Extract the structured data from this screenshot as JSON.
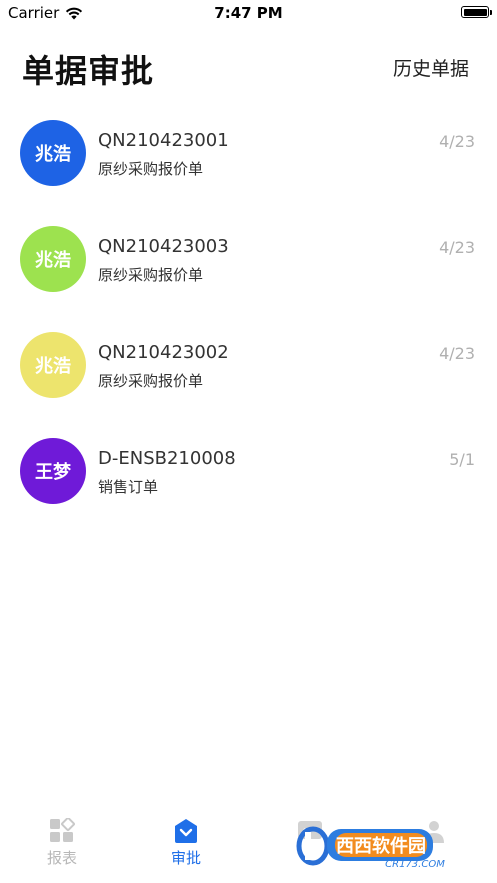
{
  "status_bar": {
    "carrier": "Carrier",
    "time": "7:47 PM"
  },
  "header": {
    "title": "单据审批",
    "history_label": "历史单据"
  },
  "items": [
    {
      "avatar_text": "兆浩",
      "avatar_color": "#1e63e5",
      "doc_no": "QN210423001",
      "doc_type": "原纱采购报价单",
      "date": "4/23"
    },
    {
      "avatar_text": "兆浩",
      "avatar_color": "#9de24f",
      "doc_no": "QN210423003",
      "doc_type": "原纱采购报价单",
      "date": "4/23"
    },
    {
      "avatar_text": "兆浩",
      "avatar_color": "#ede46d",
      "doc_no": "QN210423002",
      "doc_type": "原纱采购报价单",
      "date": "4/23"
    },
    {
      "avatar_text": "王梦",
      "avatar_color": "#6f1ad8",
      "doc_no": "D-ENSB210008",
      "doc_type": "销售订单",
      "date": "5/1"
    }
  ],
  "tabs": [
    {
      "label": "报表",
      "icon": "grid-icon",
      "active": false
    },
    {
      "label": "审批",
      "icon": "approval-icon",
      "active": true
    },
    {
      "label": "",
      "icon": "message-icon",
      "active": false
    },
    {
      "label": "",
      "icon": "person-icon",
      "active": false
    }
  ],
  "watermark": {
    "text": "西西软件园",
    "site": "CR173.COM"
  },
  "colors": {
    "accent": "#1f6fe8",
    "inactive": "#b8b8b8"
  }
}
